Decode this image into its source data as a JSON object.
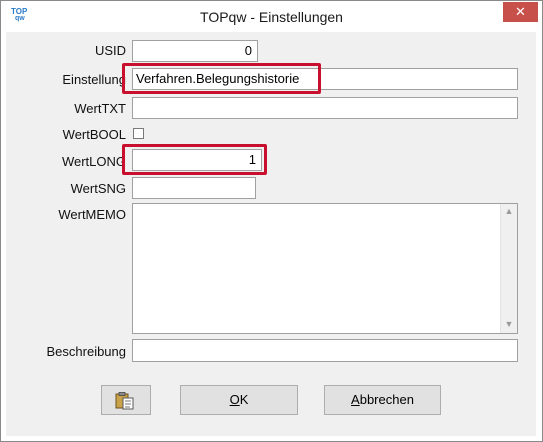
{
  "window": {
    "title": "TOPqw - Einstellungen",
    "logo_top": "TOP",
    "logo_qw": "qw",
    "close_glyph": "✕"
  },
  "form": {
    "usid": {
      "label": "USID",
      "value": "0"
    },
    "einstellung": {
      "label": "Einstellung",
      "value": "Verfahren.Belegungshistorie"
    },
    "werttxt": {
      "label": "WertTXT",
      "value": ""
    },
    "wertbool": {
      "label": "WertBOOL",
      "checked": false
    },
    "wertlong": {
      "label": "WertLONG",
      "value": "1"
    },
    "wertsng": {
      "label": "WertSNG",
      "value": ""
    },
    "wertmemo": {
      "label": "WertMEMO",
      "value": ""
    },
    "beschreibung": {
      "label": "Beschreibung",
      "value": ""
    }
  },
  "buttons": {
    "paste_icon": "clipboard-icon",
    "ok_mnemonic": "O",
    "ok_rest": "K",
    "cancel_mnemonic": "A",
    "cancel_rest": "bbrechen"
  },
  "colors": {
    "highlight": "#c8102e",
    "close": "#c7504b",
    "dialog_bg": "#f0f0f0"
  }
}
